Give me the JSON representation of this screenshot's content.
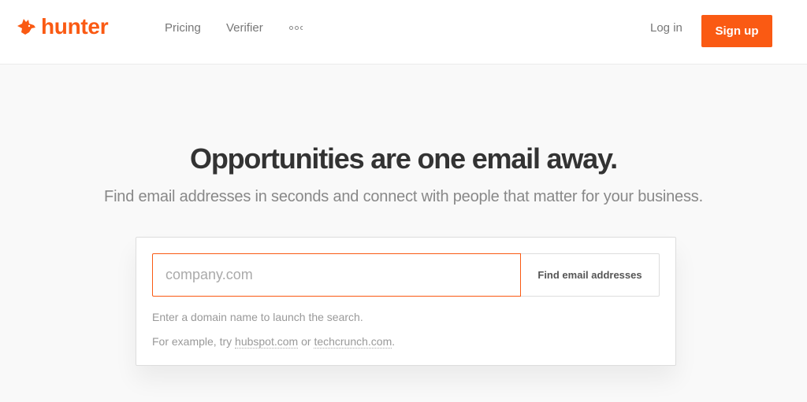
{
  "header": {
    "brand": "hunter",
    "brand_color": "#fa5a13",
    "logo_icon": "fox-head-icon",
    "nav": [
      {
        "label": "Pricing"
      },
      {
        "label": "Verifier"
      }
    ],
    "more_icon": "more-dots-icon",
    "login_label": "Log in",
    "signup_label": "Sign up"
  },
  "hero": {
    "title": "Opportunities are one email away.",
    "subtitle": "Find email addresses in seconds and connect with people that matter for your business."
  },
  "search": {
    "input_value": "",
    "input_placeholder": "company.com",
    "button_label": "Find email addresses",
    "hint": "Enter a domain name to launch the search.",
    "example_prefix": "For example, try ",
    "example_1": "hubspot.com",
    "example_joiner": " or ",
    "example_2": "techcrunch.com",
    "example_suffix": "."
  }
}
